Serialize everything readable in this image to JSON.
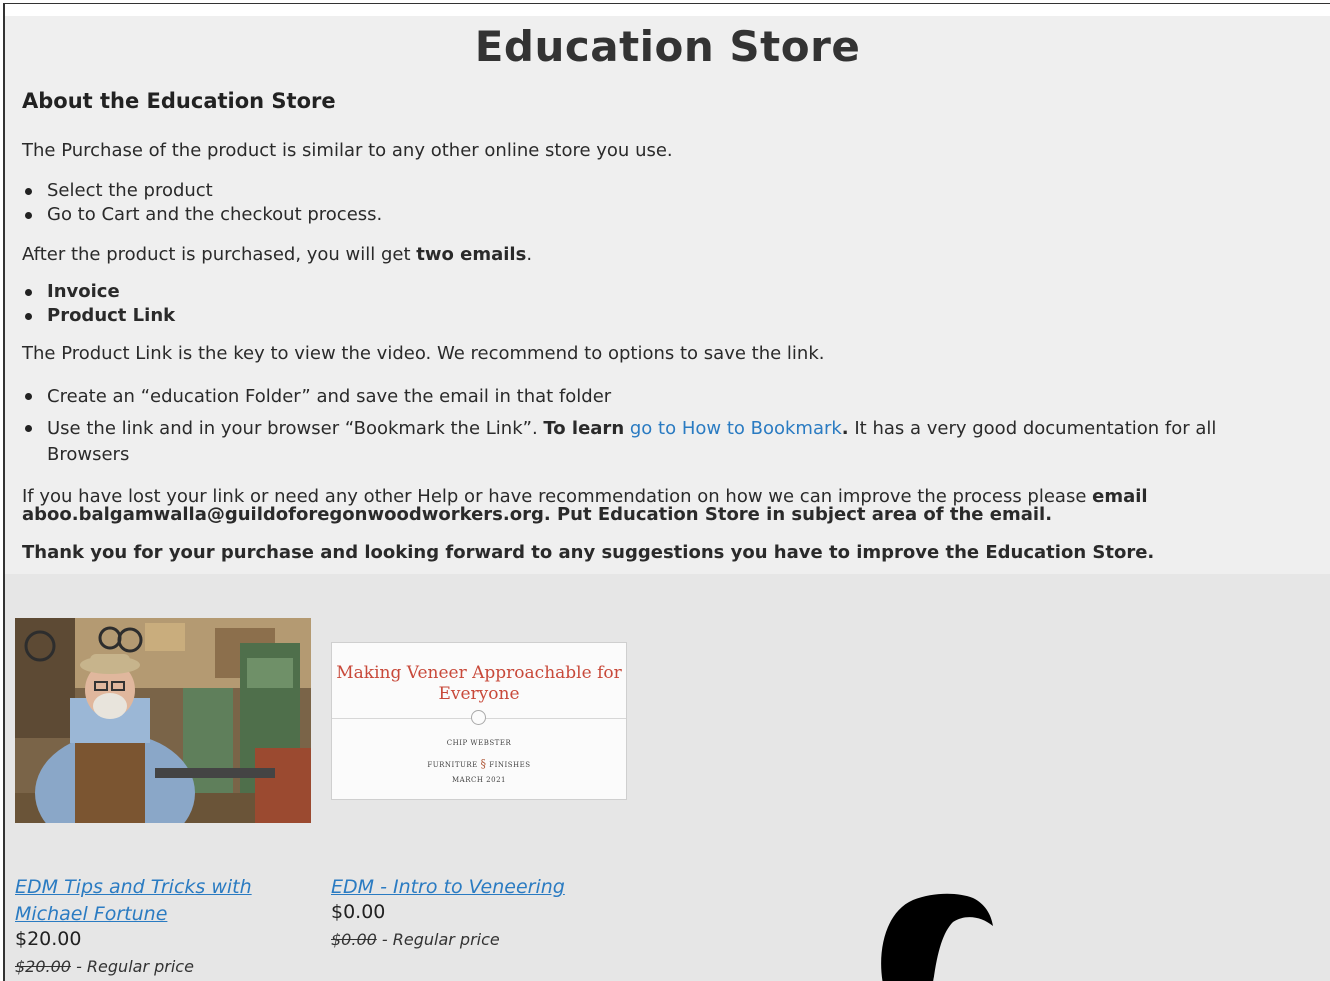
{
  "page": {
    "title": "Education Store",
    "about_heading": "About the Education Store",
    "intro": "The Purchase of the product is similar to any other online store you use.",
    "steps": [
      "Select the product",
      "Go to Cart and the checkout process."
    ],
    "emails_prefix": "After the product is purchased, you will get ",
    "emails_bold": "two emails",
    "emails_suffix": ".",
    "email_types": [
      "Invoice",
      "Product Link"
    ],
    "link_note": "The Product Link is the key to view the video.  We recommend to options to save the link.",
    "save_options": {
      "folder": "Create an “education Folder” and save the email in that folder",
      "bookmark_prefix": "Use the link and in your browser “Bookmark the Link”.  ",
      "bookmark_bold": "To learn",
      "bookmark_link": "go to How to Bookmark",
      "bookmark_dot": ".",
      "bookmark_suffix": "  It has a very good documentation for all Browsers"
    },
    "lost_link_prefix": "If you have lost your link or need any other Help or have recommendation on how we can improve the process please ",
    "lost_link_bold": "email aboo.balgamwalla@guildoforegonwoodworkers.org.  Put Education Store in subject area of the email.",
    "thanks": "Thank you for your purchase and looking forward to any suggestions you have to improve the Education Store."
  },
  "products": [
    {
      "name": "EDM Tips and Tricks with Michael Fortune",
      "price": "$20.00",
      "regular_price": "$20.00",
      "regular_label": " - Regular price"
    },
    {
      "name": "EDM - Intro to Veneering",
      "price": "$0.00",
      "regular_price": "$0.00",
      "regular_label": " - Regular price",
      "thumbnail_text": {
        "title": "Making Veneer Approachable for Everyone",
        "author": "CHIP WEBSTER",
        "brand_left": "FURNITURE",
        "brand_right": "FINISHES",
        "date": "MARCH 2021"
      }
    }
  ],
  "colors": {
    "link": "#2a7bc2",
    "background": "#efefef",
    "veneer_title": "#c8493a"
  },
  "icons": {
    "mascot": "beaver-silhouette-icon"
  }
}
